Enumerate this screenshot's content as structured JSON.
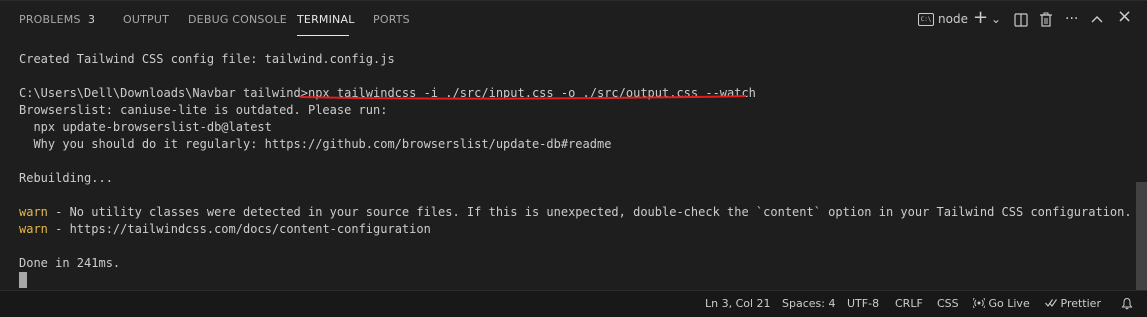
{
  "tabs": [
    {
      "label": "PROBLEMS",
      "badge": "3"
    },
    {
      "label": "OUTPUT"
    },
    {
      "label": "DEBUG CONSOLE"
    },
    {
      "label": "TERMINAL",
      "active": true
    },
    {
      "label": "PORTS"
    }
  ],
  "actions": {
    "terminal_icon_text": "C:\\",
    "node_label": "node",
    "add_icon": "+",
    "chevron_icon": "⌄",
    "split_icon": "▯",
    "trash_icon": "🗑",
    "more_icon": "···",
    "maximize_icon": "^",
    "close_icon": "×"
  },
  "terminal": {
    "lines": [
      {
        "text": "Created Tailwind CSS config file: tailwind.config.js"
      },
      {
        "text": "C:\\Users\\Dell\\Downloads\\Navbar tailwind>npx tailwindcss -i ./src/input.css -o ./src/output.css --watch"
      },
      {
        "text": "Browserslist: caniuse-lite is outdated. Please run:"
      },
      {
        "text": "  npx update-browserslist-db@latest"
      },
      {
        "text": "  Why you should do it regularly: https://github.com/browserslist/update-db#readme"
      },
      {
        "text": "Rebuilding..."
      },
      {
        "warn": "warn",
        "text": " - No utility classes were detected in your source files. If this is unexpected, double-check the `content` option in your Tailwind CSS configuration."
      },
      {
        "warn": "warn",
        "text": " - https://tailwindcss.com/docs/content-configuration"
      },
      {
        "text": "Done in 241ms."
      }
    ]
  },
  "status": {
    "ln_col": "Ln 3, Col 21",
    "spaces": "Spaces: 4",
    "encoding": "UTF-8",
    "eol": "CRLF",
    "language": "CSS",
    "go_live": "Go Live",
    "prettier": "Prettier",
    "bell_icon": "bell"
  },
  "colors": {
    "background": "#1e1e1e",
    "warn": "#e5b94c",
    "annotation_red": "#e01e1e"
  }
}
